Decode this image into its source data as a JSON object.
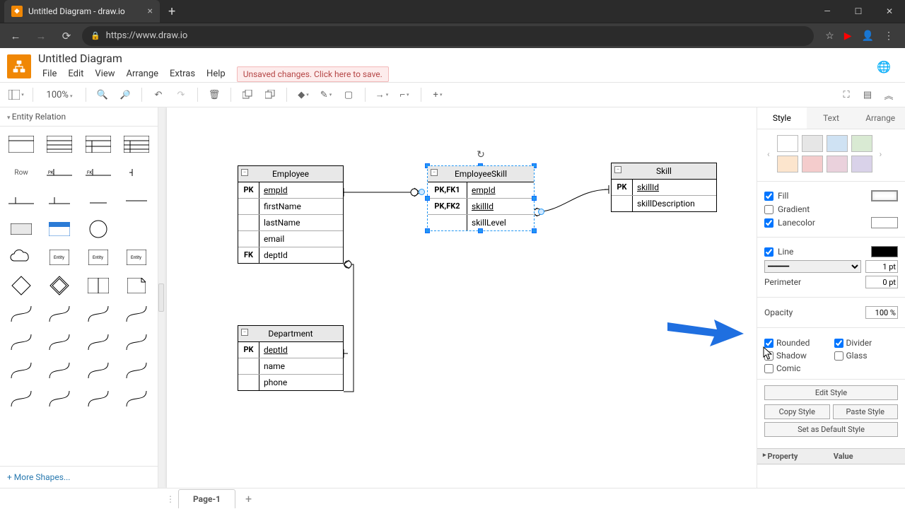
{
  "browser": {
    "tab_title": "Untitled Diagram - draw.io",
    "url": "https://www.draw.io"
  },
  "app": {
    "doc_title": "Untitled Diagram",
    "menu": {
      "file": "File",
      "edit": "Edit",
      "view": "View",
      "arrange": "Arrange",
      "extras": "Extras",
      "help": "Help"
    },
    "save_warning": "Unsaved changes. Click here to save.",
    "zoom": "100%"
  },
  "sidebar": {
    "section": "Entity Relation",
    "row_label": "Row",
    "more_shapes": "+ More Shapes..."
  },
  "canvas": {
    "tables": {
      "employee": {
        "title": "Employee",
        "rows": [
          {
            "key": "PK",
            "name": "empId",
            "u": true
          },
          {
            "key": "",
            "name": "firstName"
          },
          {
            "key": "",
            "name": "lastName"
          },
          {
            "key": "",
            "name": "email"
          },
          {
            "key": "FK",
            "name": "deptId"
          }
        ]
      },
      "employeeskill": {
        "title": "EmployeeSkill",
        "rows": [
          {
            "key": "PK,FK1",
            "name": "empId",
            "u": true
          },
          {
            "key": "PK,FK2",
            "name": "skillId",
            "u": true
          },
          {
            "key": "",
            "name": "skillLevel"
          }
        ]
      },
      "skill": {
        "title": "Skill",
        "rows": [
          {
            "key": "PK",
            "name": "skillId",
            "u": true
          },
          {
            "key": "",
            "name": "skillDescription"
          }
        ]
      },
      "department": {
        "title": "Department",
        "rows": [
          {
            "key": "PK",
            "name": "deptId",
            "u": true
          },
          {
            "key": "",
            "name": "name"
          },
          {
            "key": "",
            "name": "phone"
          }
        ]
      }
    }
  },
  "rpanel": {
    "tabs": {
      "style": "Style",
      "text": "Text",
      "arrange": "Arrange"
    },
    "fill": "Fill",
    "gradient": "Gradient",
    "lanecolor": "Lanecolor",
    "line": "Line",
    "perimeter": "Perimeter",
    "opacity": "Opacity",
    "line_width": "1 pt",
    "perimeter_val": "0 pt",
    "opacity_val": "100 %",
    "rounded": "Rounded",
    "divider": "Divider",
    "shadow": "Shadow",
    "glass": "Glass",
    "comic": "Comic",
    "edit_style": "Edit Style",
    "copy_style": "Copy Style",
    "paste_style": "Paste Style",
    "default_style": "Set as Default Style",
    "property": "Property",
    "value": "Value",
    "colors": {
      "fill_chip": "#ffffff",
      "lane_chip": "#ffffff",
      "line_chip": "#000000",
      "swatches": [
        "#ffffff",
        "#e6e6e6",
        "#cfe2f3",
        "#d9ead3",
        "#fce5cd",
        "#f4cccc",
        "#ead1dc",
        "#d9d2e9"
      ]
    }
  },
  "footer": {
    "page": "Page-1"
  }
}
